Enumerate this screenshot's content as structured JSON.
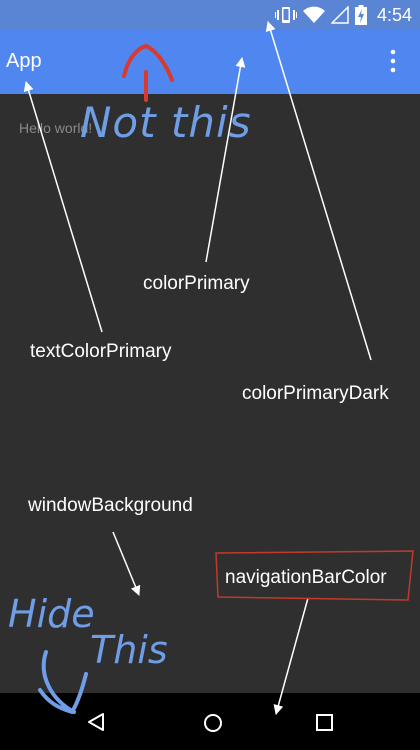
{
  "status_bar": {
    "time": "4:54",
    "icons": [
      "vibrate-icon",
      "wifi-icon",
      "cell-signal-icon",
      "battery-charging-icon"
    ]
  },
  "app_bar": {
    "title": "App",
    "overflow_icon": "overflow-menu-icon"
  },
  "content": {
    "hello_text": "Hello world!"
  },
  "annotations": {
    "not_this": "Not this",
    "hide_this_line1": "Hide",
    "hide_this_line2": "This",
    "color_primary": "colorPrimary",
    "text_color_primary": "textColorPrimary",
    "color_primary_dark": "colorPrimaryDark",
    "window_background": "windowBackground",
    "navigation_bar_color": "navigationBarColor"
  },
  "nav_bar": {
    "buttons": [
      "back-icon",
      "home-icon",
      "recents-icon"
    ]
  },
  "colors": {
    "status_bar": "#5a85d4",
    "app_bar": "#4f86f0",
    "window_background": "#2f2f2f",
    "nav_bar": "#000000",
    "handwriting_blue": "#6f9ee6",
    "handwriting_red": "#d83a2e"
  }
}
